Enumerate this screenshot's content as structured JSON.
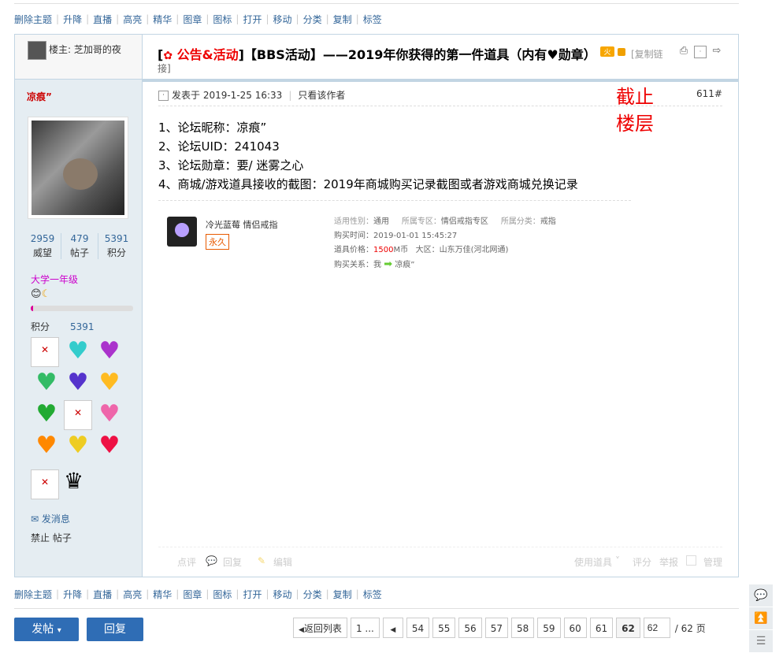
{
  "mod_bar": [
    "删除主题",
    "升降",
    "直播",
    "高亮",
    "精华",
    "图章",
    "图标",
    "打开",
    "移动",
    "分类",
    "复制",
    "标签"
  ],
  "thread": {
    "op_label": "楼主: 芝加哥的夜",
    "bracket_open": "[",
    "category": "公告&活动",
    "bracket_close": "]",
    "title": "【BBS活动】——2019年你获得的第一件道具（内有♥勋章）",
    "hot_badge": "火",
    "copy_link": "[复制链",
    "copy_link_tail": "接]"
  },
  "user": {
    "name": "凉痕”",
    "stats": [
      {
        "value": "2959",
        "label": "威望"
      },
      {
        "value": "479",
        "label": "帖子"
      },
      {
        "value": "5391",
        "label": "积分"
      }
    ],
    "level": "大学一年级",
    "level_progress": 0.02,
    "score_label": "积分",
    "score_value": "5391",
    "send_msg": "发消息",
    "ban": "禁止 帖子"
  },
  "post": {
    "posted_at": "发表于 2019-1-25 16:33",
    "only_author": "只看该作者",
    "floor": "611#",
    "cutoff_line1": "截止",
    "cutoff_line2": "楼层",
    "lines": [
      "1、论坛昵称：凉痕”",
      "2、论坛UID：241043",
      "3、论坛勋章：要/ 迷雾之心",
      "4、商城/游戏道具接收的截图：2019年商城购买记录截图或者游戏商城兑换记录"
    ]
  },
  "item_card": {
    "name": "冷光蓝莓 情侣戒指",
    "tag": "永久",
    "gender_label": "适用性别：",
    "gender_value": "通用",
    "zone_label": "所属专区：",
    "zone_value": "情侣戒指专区",
    "class_label": "所属分类：",
    "class_value": "戒指",
    "buy_time": "购买时间：2019-01-01 15:45:27",
    "price_label": "道具价格：",
    "price_value": "1500",
    "price_unit": "M币",
    "region": "大区：山东万佳(河北网通)",
    "relation_label": "购买关系：",
    "relation_from": "我",
    "relation_to": "凉痕”"
  },
  "post_actions": {
    "rate": "点评",
    "reply": "回复",
    "edit": "编辑",
    "use_item": "使用道具",
    "score": "评分",
    "report": "举报",
    "manage": "管理"
  },
  "footer": {
    "post_btn": "发帖",
    "reply_btn": "回复",
    "back_list": "返回列表",
    "first": "1 ...",
    "pages": [
      "54",
      "55",
      "56",
      "57",
      "58",
      "59",
      "60",
      "61"
    ],
    "current": "62",
    "input_value": "62",
    "total": "/ 62 页"
  },
  "colors": {
    "accent": "#2f6db5",
    "border": "#c2d5e3",
    "left_bg": "#e5edf2",
    "red": "#e00000"
  }
}
